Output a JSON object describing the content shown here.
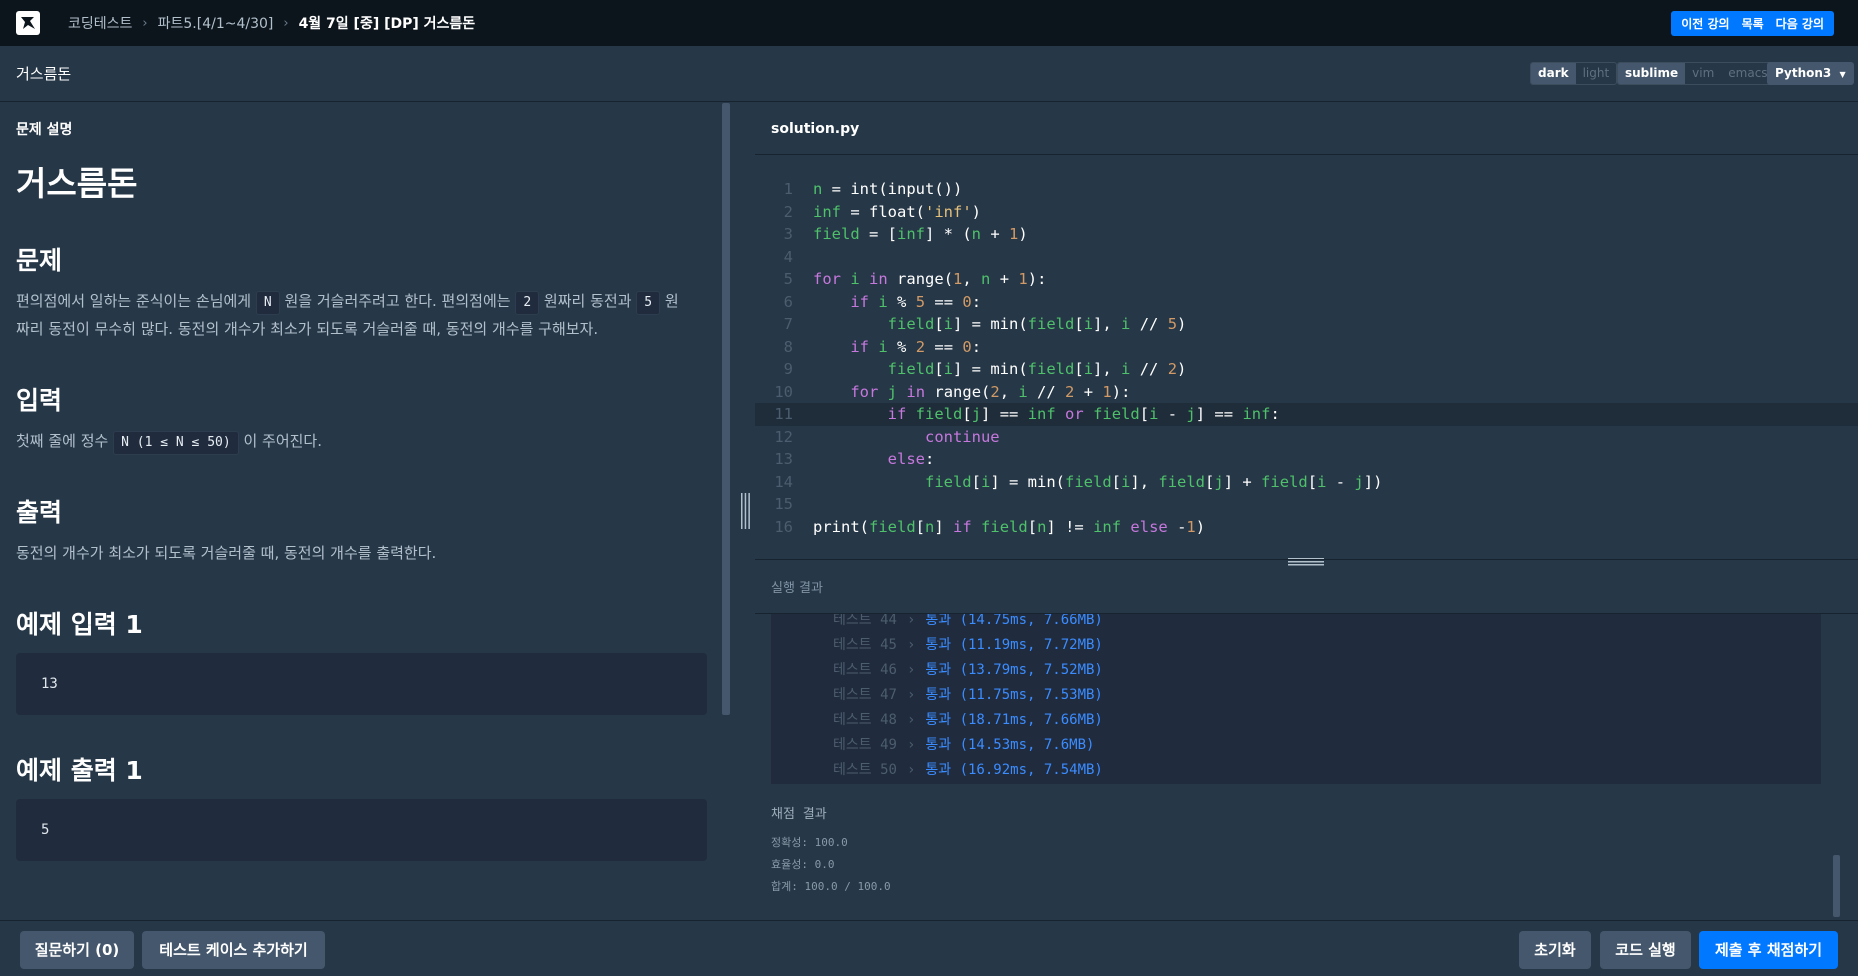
{
  "nav": {
    "breadcrumbs": [
      "코딩테스트",
      "파트5.[4/1~4/30]"
    ],
    "current": "4월 7일 [중] [DP] 거스름돈",
    "prev_label": "이전 강의",
    "list_label": "목록",
    "next_label": "다음 강의"
  },
  "header": {
    "title": "거스름돈",
    "theme_options": [
      "dark",
      "light"
    ],
    "theme_selected": "dark",
    "keymap_options": [
      "sublime",
      "vim",
      "emacs"
    ],
    "keymap_selected": "sublime",
    "language": "Python3"
  },
  "problem": {
    "section_label": "문제 설명",
    "title": "거스름돈",
    "h_problem": "문제",
    "desc_p1": "편의점에서 일하는 준식이는 손님에게 ",
    "desc_c1": "N",
    "desc_p2": " 원을 거슬러주려고 한다. 편의점에는 ",
    "desc_c2": "2",
    "desc_p3": " 원짜리 동전과 ",
    "desc_c3": "5",
    "desc_p4": " 원",
    "desc_line2": "짜리 동전이 무수히 많다. 동전의 개수가 최소가 되도록 거슬러줄 때, 동전의 개수를 구해보자.",
    "h_input": "입력",
    "input_p1": "첫째 줄에 정수 ",
    "input_code": "N (1 ≤ N ≤ 50)",
    "input_p2": " 이 주어진다.",
    "h_output": "출력",
    "output_text": "동전의 개수가 최소가 되도록 거슬러줄 때, 동전의 개수를 출력한다.",
    "h_example_in": "예제 입력 1",
    "example_in": "13",
    "h_example_out": "예제 출력 1",
    "example_out": "5"
  },
  "editor": {
    "filename": "solution.py",
    "code_lines": [
      "n = int(input())",
      "inf = float('inf')",
      "field = [inf] * (n + 1)",
      "",
      "for i in range(1, n + 1):",
      "    if i % 5 == 0:",
      "        field[i] = min(field[i], i // 5)",
      "    if i % 2 == 0:",
      "        field[i] = min(field[i], i // 2)",
      "    for j in range(2, i // 2 + 1):",
      "        if field[j] == inf or field[i - j] == inf:",
      "            continue",
      "        else:",
      "            field[i] = min(field[i], field[j] + field[i - j])",
      "",
      "print(field[n] if field[n] != inf else -1)"
    ],
    "active_line": 11
  },
  "results": {
    "label": "실행 결과",
    "rows": [
      {
        "test": "테스트 44",
        "result": "통과 (14.75ms, 7.66MB)"
      },
      {
        "test": "테스트 45",
        "result": "통과 (11.19ms, 7.72MB)"
      },
      {
        "test": "테스트 46",
        "result": "통과 (13.79ms, 7.52MB)"
      },
      {
        "test": "테스트 47",
        "result": "통과 (11.75ms, 7.53MB)"
      },
      {
        "test": "테스트 48",
        "result": "통과 (18.71ms, 7.66MB)"
      },
      {
        "test": "테스트 49",
        "result": "통과 (14.53ms, 7.6MB)"
      },
      {
        "test": "테스트 50",
        "result": "통과 (16.92ms, 7.54MB)"
      }
    ],
    "grade_title": "채점 결과",
    "accuracy": "정확성: 100.0",
    "efficiency": "효율성: 0.0",
    "total": "합계: 100.0 / 100.0"
  },
  "footer": {
    "question_label": "질문하기 (0)",
    "add_testcase_label": "테스트 케이스 추가하기",
    "reset_label": "초기화",
    "run_label": "코드 실행",
    "submit_label": "제출 후 채점하기"
  },
  "colors": {
    "accent": "#0078ff",
    "bg": "#263747",
    "nav_bg": "#0c151c",
    "code_bg": "#202b3d",
    "pass": "#3b8cff"
  }
}
